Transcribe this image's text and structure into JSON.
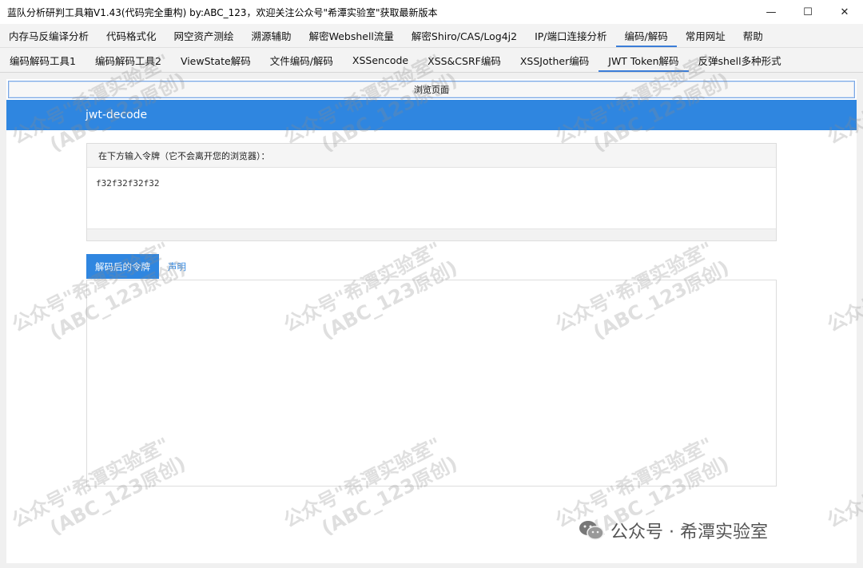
{
  "window": {
    "title": "蓝队分析研判工具箱V1.43(代码完全重构) by:ABC_123，欢迎关注公众号\"希潭实验室\"获取最新版本",
    "controls": {
      "minimize": "—",
      "maximize": "☐",
      "close": "✕"
    }
  },
  "menu": [
    {
      "label": "内存马反编译分析",
      "active": false
    },
    {
      "label": "代码格式化",
      "active": false
    },
    {
      "label": "网空资产测绘",
      "active": false
    },
    {
      "label": "溯源辅助",
      "active": false
    },
    {
      "label": "解密Webshell流量",
      "active": false
    },
    {
      "label": "解密Shiro/CAS/Log4j2",
      "active": false
    },
    {
      "label": "IP/端口连接分析",
      "active": false
    },
    {
      "label": "编码/解码",
      "active": true
    },
    {
      "label": "常用网址",
      "active": false
    },
    {
      "label": "帮助",
      "active": false
    }
  ],
  "subtabs": [
    {
      "label": "编码解码工具1",
      "active": false
    },
    {
      "label": "编码解码工具2",
      "active": false
    },
    {
      "label": "ViewState解码",
      "active": false
    },
    {
      "label": "文件编码/解码",
      "active": false
    },
    {
      "label": "XSSencode",
      "active": false
    },
    {
      "label": "XSS&CSRF编码",
      "active": false
    },
    {
      "label": "XSSJother编码",
      "active": false
    },
    {
      "label": "JWT Token解码",
      "active": true
    },
    {
      "label": "反弹shell多种形式",
      "active": false
    }
  ],
  "browse_button": "浏览页面",
  "header_title": "jwt-decode",
  "input_panel": {
    "heading": "在下方输入令牌（它不会离开您的浏览器）：",
    "value": "f32f32f32f32"
  },
  "output_tabs": [
    {
      "label": "解码后的令牌",
      "active": true
    },
    {
      "label": "声明",
      "active": false
    }
  ],
  "watermark": {
    "line1": "公众号\"希潭实验室\"",
    "line2": "(ABC_123原创)"
  },
  "brand": {
    "icon": "wechat-icon",
    "text": "公众号 · 希潭实验室"
  }
}
